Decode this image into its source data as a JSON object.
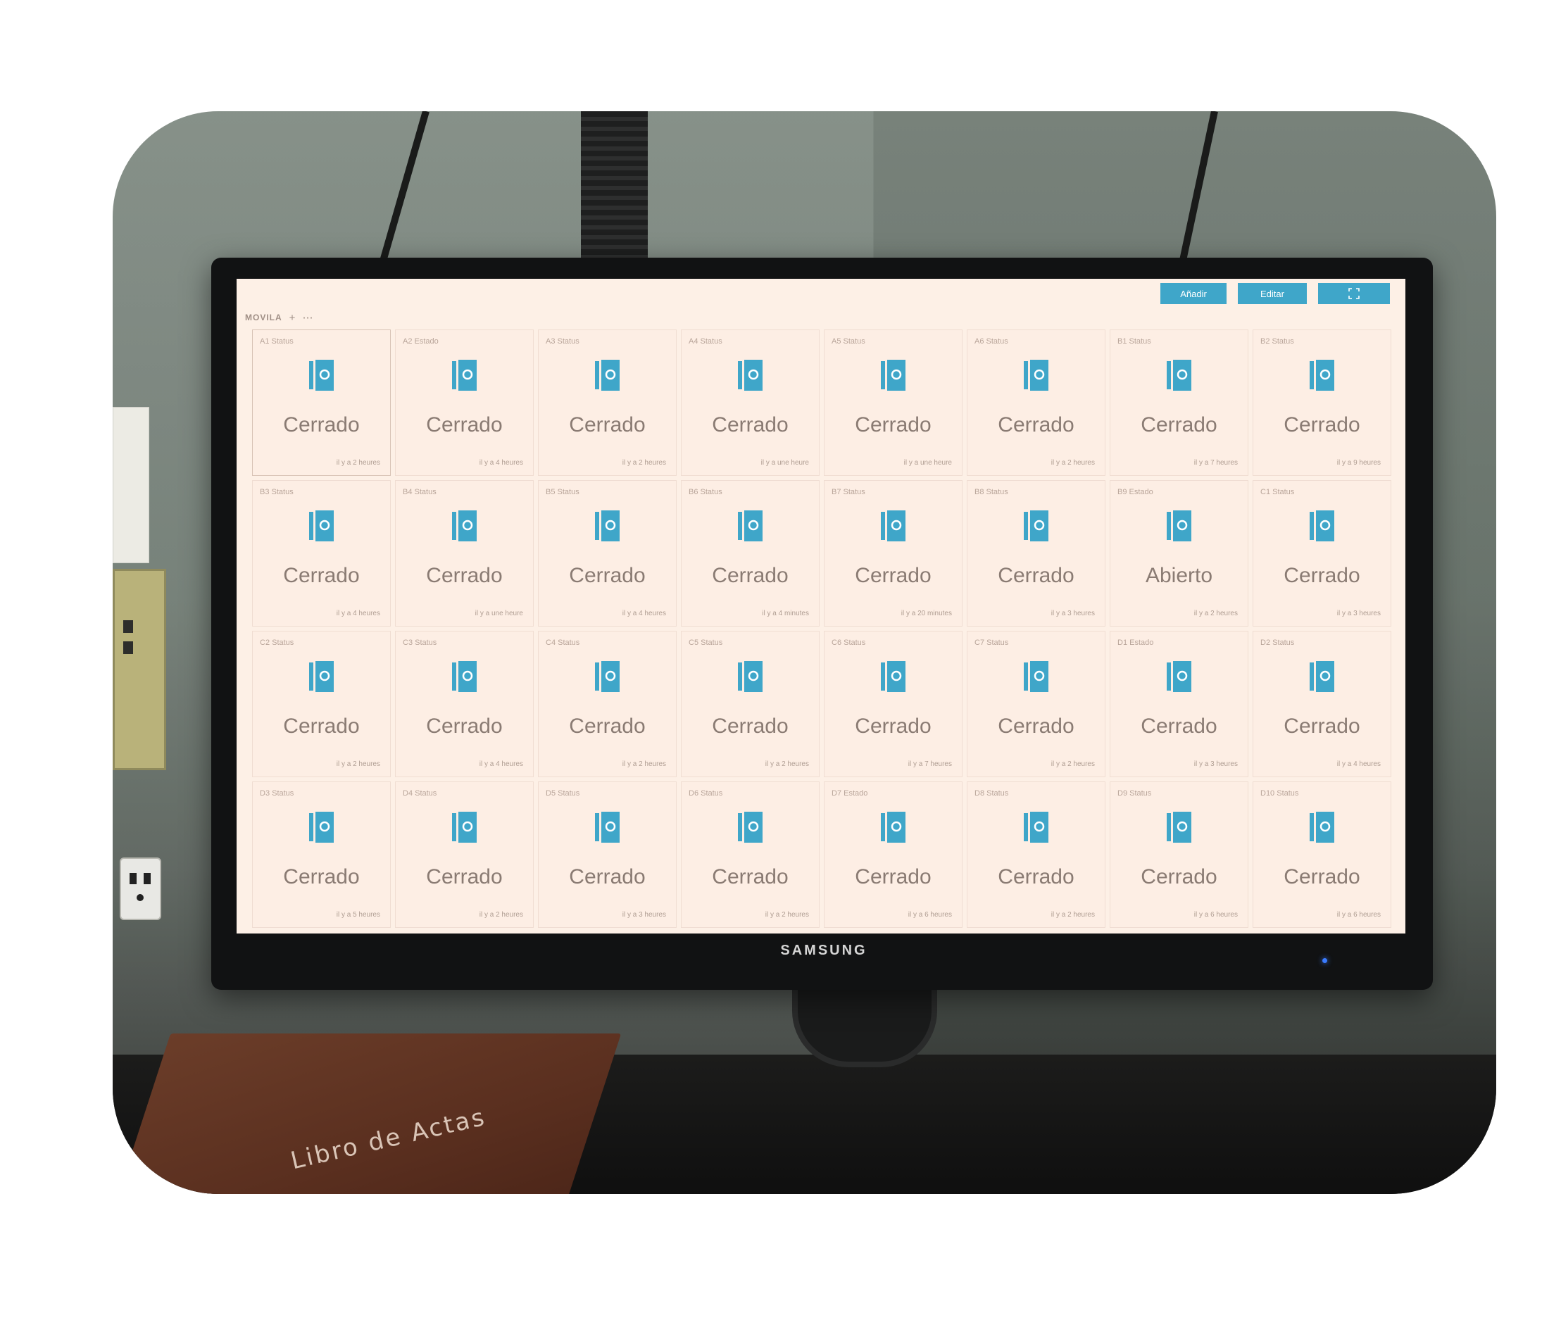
{
  "colors": {
    "accent": "#3fa6c9",
    "screen_bg": "#fdf0e6",
    "card_bg": "#fdeee4",
    "state_text": "#8a7b73"
  },
  "toolbar": {
    "add_label": "Añadir",
    "edit_label": "Editar",
    "fullscreen_icon": "fullscreen-icon"
  },
  "view": {
    "name": "MOVILA",
    "add_icon": "+",
    "more_icon": "⋯"
  },
  "monitor": {
    "brand": "SAMSUNG"
  },
  "book": {
    "title": "Libro de Actas"
  },
  "cards": [
    {
      "label": "A1 Status",
      "state": "Cerrado",
      "time": "il y a 2 heures"
    },
    {
      "label": "A2 Estado",
      "state": "Cerrado",
      "time": "il y a 4 heures"
    },
    {
      "label": "A3 Status",
      "state": "Cerrado",
      "time": "il y a 2 heures"
    },
    {
      "label": "A4 Status",
      "state": "Cerrado",
      "time": "il y a une heure"
    },
    {
      "label": "A5 Status",
      "state": "Cerrado",
      "time": "il y a une heure"
    },
    {
      "label": "A6 Status",
      "state": "Cerrado",
      "time": "il y a 2 heures"
    },
    {
      "label": "B1 Status",
      "state": "Cerrado",
      "time": "il y a 7 heures"
    },
    {
      "label": "B2 Status",
      "state": "Cerrado",
      "time": "il y a 9 heures"
    },
    {
      "label": "B3 Status",
      "state": "Cerrado",
      "time": "il y a 4 heures"
    },
    {
      "label": "B4 Status",
      "state": "Cerrado",
      "time": "il y a une heure"
    },
    {
      "label": "B5 Status",
      "state": "Cerrado",
      "time": "il y a 4 heures"
    },
    {
      "label": "B6 Status",
      "state": "Cerrado",
      "time": "il y a 4 minutes"
    },
    {
      "label": "B7 Status",
      "state": "Cerrado",
      "time": "il y a 20 minutes"
    },
    {
      "label": "B8 Status",
      "state": "Cerrado",
      "time": "il y a 3 heures"
    },
    {
      "label": "B9 Estado",
      "state": "Abierto",
      "time": "il y a 2 heures"
    },
    {
      "label": "C1 Status",
      "state": "Cerrado",
      "time": "il y a 3 heures"
    },
    {
      "label": "C2 Status",
      "state": "Cerrado",
      "time": "il y a 2 heures"
    },
    {
      "label": "C3 Status",
      "state": "Cerrado",
      "time": "il y a 4 heures"
    },
    {
      "label": "C4 Status",
      "state": "Cerrado",
      "time": "il y a 2 heures"
    },
    {
      "label": "C5 Status",
      "state": "Cerrado",
      "time": "il y a 2 heures"
    },
    {
      "label": "C6 Status",
      "state": "Cerrado",
      "time": "il y a 7 heures"
    },
    {
      "label": "C7 Status",
      "state": "Cerrado",
      "time": "il y a 2 heures"
    },
    {
      "label": "D1 Estado",
      "state": "Cerrado",
      "time": "il y a 3 heures"
    },
    {
      "label": "D2 Status",
      "state": "Cerrado",
      "time": "il y a 4 heures"
    },
    {
      "label": "D3 Status",
      "state": "Cerrado",
      "time": "il y a 5 heures"
    },
    {
      "label": "D4 Status",
      "state": "Cerrado",
      "time": "il y a 2 heures"
    },
    {
      "label": "D5 Status",
      "state": "Cerrado",
      "time": "il y a 3 heures"
    },
    {
      "label": "D6 Status",
      "state": "Cerrado",
      "time": "il y a 2 heures"
    },
    {
      "label": "D7 Estado",
      "state": "Cerrado",
      "time": "il y a 6 heures"
    },
    {
      "label": "D8 Status",
      "state": "Cerrado",
      "time": "il y a 2 heures"
    },
    {
      "label": "D9 Status",
      "state": "Cerrado",
      "time": "il y a 6 heures"
    },
    {
      "label": "D10 Status",
      "state": "Cerrado",
      "time": "il y a 6 heures"
    }
  ]
}
